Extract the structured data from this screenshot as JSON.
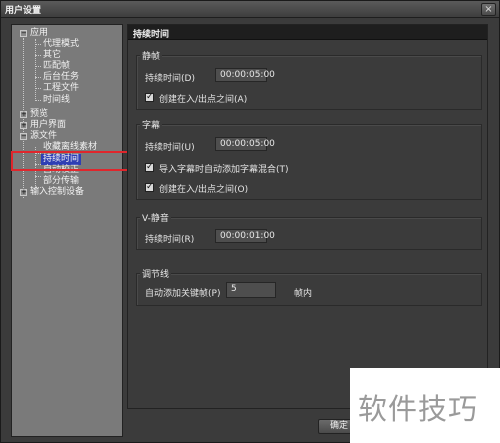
{
  "window": {
    "title": "用户设置",
    "close_glyph": "×"
  },
  "tree": {
    "items": [
      {
        "label": "应用",
        "expander": "−"
      },
      {
        "label": "代理模式"
      },
      {
        "label": "其它"
      },
      {
        "label": "匹配帧"
      },
      {
        "label": "后台任务"
      },
      {
        "label": "工程文件"
      },
      {
        "label": "时间线"
      },
      {
        "label": "预览",
        "expander": "+"
      },
      {
        "label": "用户界面",
        "expander": "+"
      },
      {
        "label": "源文件",
        "expander": "−"
      },
      {
        "label": "收藏离线素材"
      },
      {
        "label": "持续时间",
        "selected": true
      },
      {
        "label": "自动校正"
      },
      {
        "label": "部分传输"
      },
      {
        "label": "输入控制设备",
        "expander": "+"
      }
    ]
  },
  "panel": {
    "header": "持续时间",
    "still": {
      "title": "静帧",
      "duration_label": "持续时间(D)",
      "duration_value": "00:00:05:00",
      "create_between_label": "创建在入/出点之间(A)",
      "create_between_checked": true
    },
    "subtitle": {
      "title": "字幕",
      "duration_label": "持续时间(U)",
      "duration_value": "00:00:05:00",
      "import_mix_label": "导入字幕时自动添加字幕混合(T)",
      "import_mix_checked": true,
      "create_between_label": "创建在入/出点之间(O)",
      "create_between_checked": true
    },
    "vmute": {
      "title": "V-静音",
      "duration_label": "持续时间(R)",
      "duration_value": "00:00:01:00"
    },
    "rubber": {
      "title": "调节线",
      "auto_keyframe_label": "自动添加关键帧(P)",
      "auto_keyframe_value": "5",
      "unit_label": "帧内"
    }
  },
  "footer": {
    "ok_label": "确定"
  },
  "watermark": {
    "text": "软件技巧"
  },
  "check_glyph": "✓",
  "colors": {
    "selection": "#2f3fb4",
    "highlight_box": "#e0262c",
    "tree_bg": "#7a7a7a"
  }
}
